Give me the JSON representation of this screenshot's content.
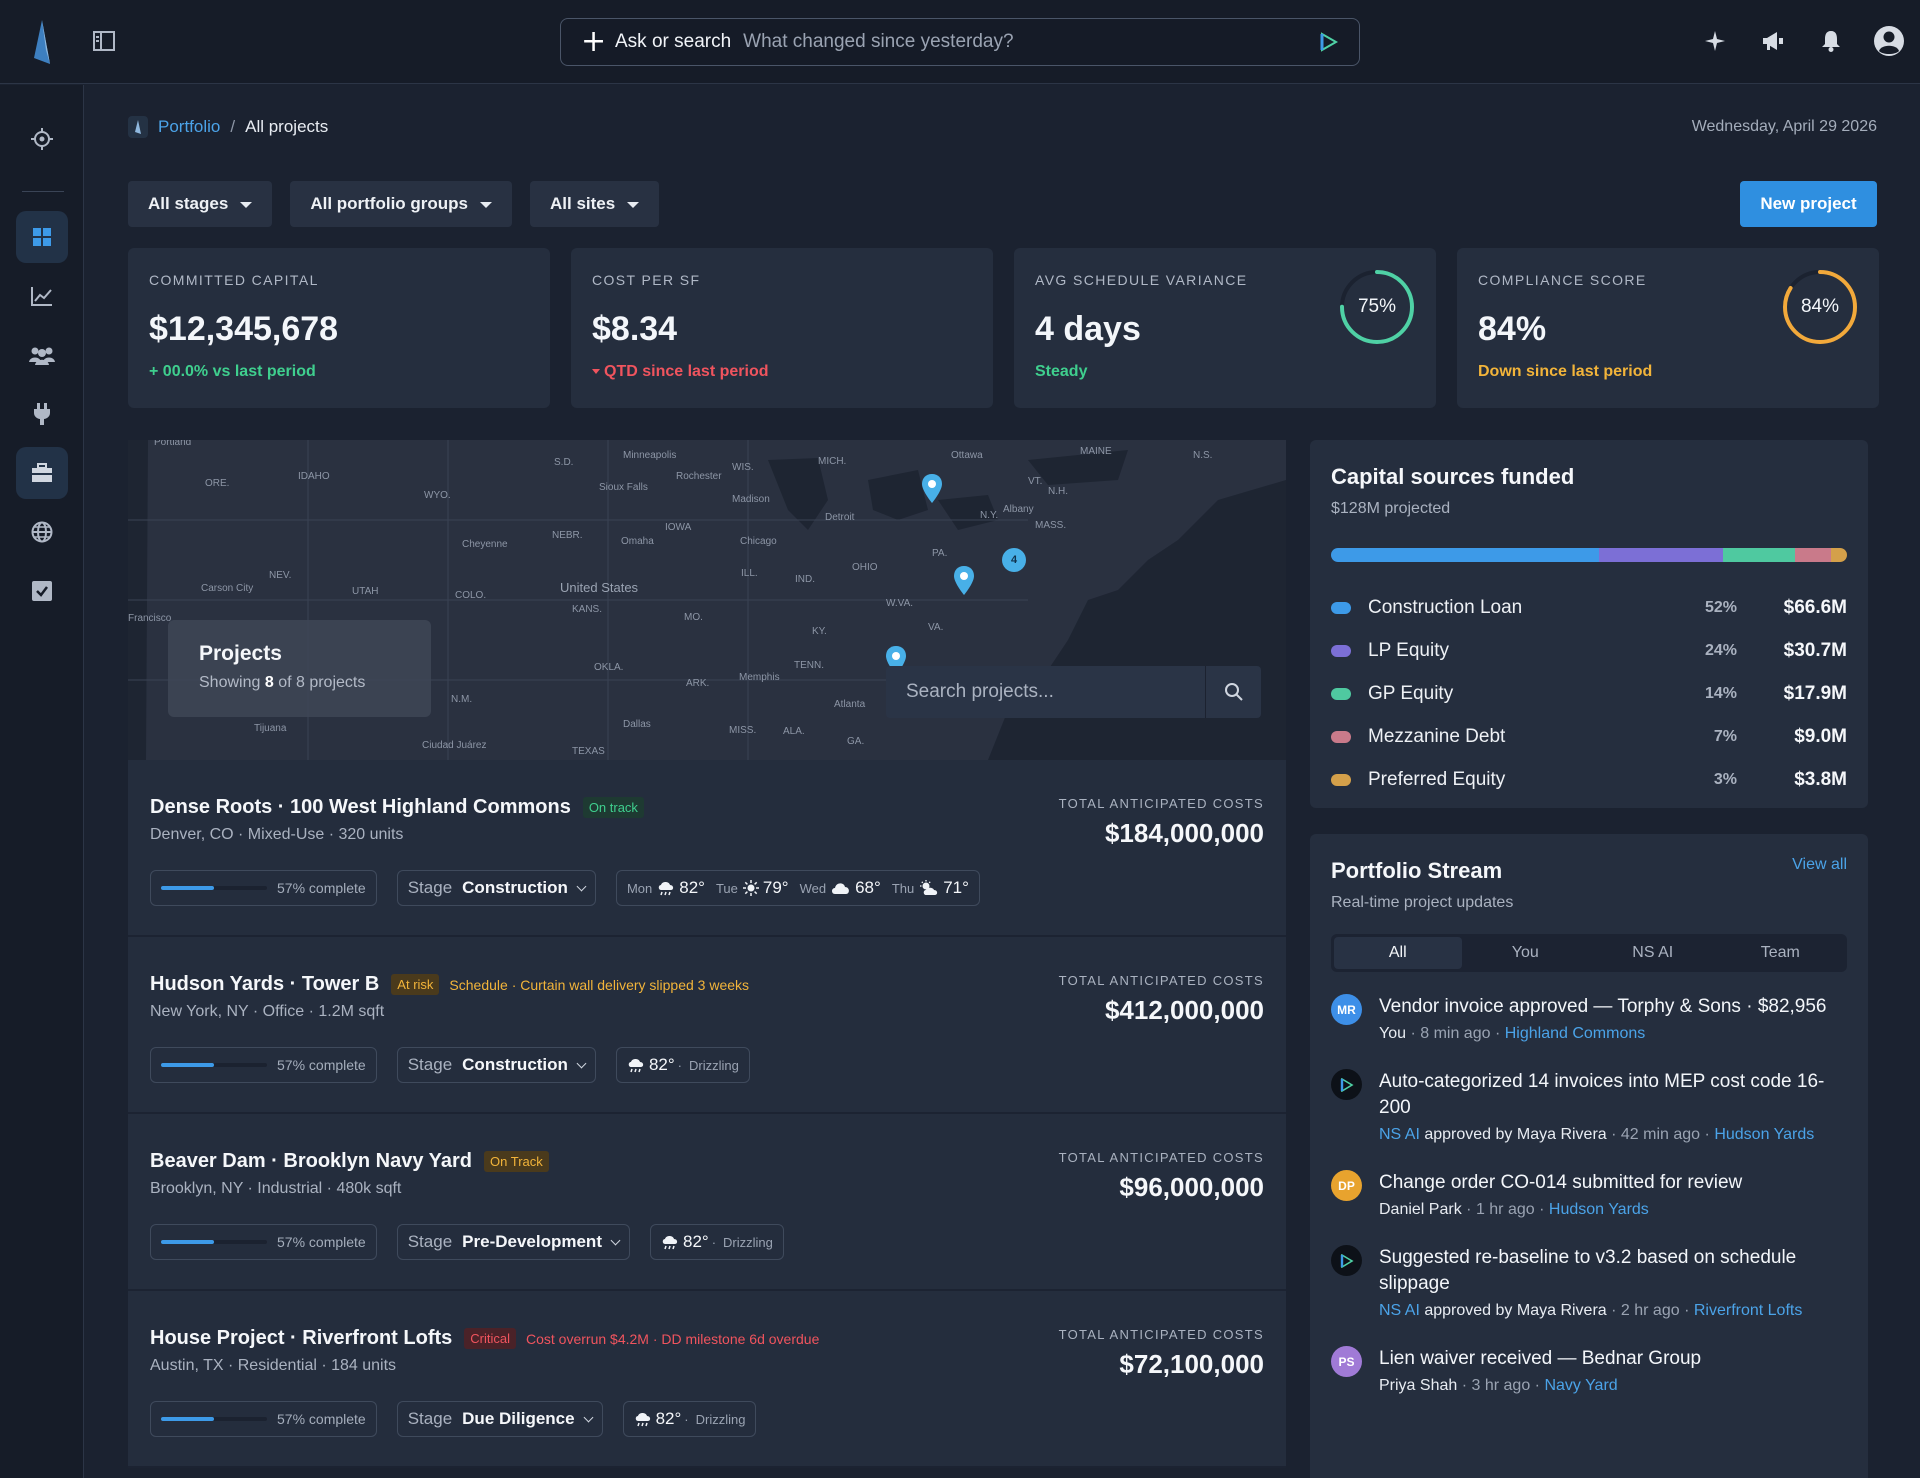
{
  "app": {
    "search_label": "Ask or search",
    "search_placeholder": "What changed since yesterday?"
  },
  "breadcrumb": {
    "root": "Portfolio",
    "current": "All projects"
  },
  "date": "Wednesday, April 29 2026",
  "filters": [
    "All stages",
    "All portfolio groups",
    "All sites"
  ],
  "new_project_label": "New project",
  "kpis": [
    {
      "label": "COMMITTED CAPITAL",
      "value": "$12,345,678",
      "sub": "+ 00.0% vs last period",
      "sub_color": "#3fcf8e"
    },
    {
      "label": "COST PER SF",
      "value": "$8.34",
      "sub": "QTD since last period",
      "sub_color": "#f0545e"
    },
    {
      "label": "AVG SCHEDULE VARIANCE",
      "value": "4 days",
      "sub": "Steady",
      "sub_color": "#3fcf8e",
      "ring_text": "75%",
      "ring_value": 0.75,
      "ring_color": "#4fd1a5"
    },
    {
      "label": "COMPLIANCE SCORE",
      "value": "84%",
      "sub": "Down since last period",
      "sub_color": "#f2b43a",
      "ring_text": "84%",
      "ring_value": 0.84,
      "ring_color": "#f2a93b"
    }
  ],
  "map": {
    "overlay_title": "Projects",
    "overlay_prefix": "Showing",
    "overlay_count": "8",
    "overlay_suffix": "of 8 projects",
    "search_placeholder": "Search projects...",
    "cluster_count": "4",
    "labels": [
      "Minneapolis",
      "Ottawa",
      "MAINE",
      "N.S.",
      "MICH.",
      "Rochester",
      "WIS.",
      "Sioux Falls",
      "S.D.",
      "Madison",
      "IDAHO",
      "ORE.",
      "WYO.",
      "Albany",
      "N.Y.",
      "VT.",
      "N.H.",
      "MASS.",
      "Detroit",
      "IOWA",
      "NEBR.",
      "Omaha",
      "Chicago",
      "Cheyenne",
      "PA.",
      "NEV.",
      "Carson City",
      "UTAH",
      "COLO.",
      "ILL.",
      "IND.",
      "OHIO",
      "United States",
      "KANS.",
      "MO.",
      "W.VA.",
      "VA.",
      "Francisco",
      "KY.",
      "TENN.",
      "OKLA.",
      "ARK.",
      "Memphis",
      "Atlanta",
      "N.M.",
      "Tijuana",
      "Dallas",
      "MISS.",
      "ALA.",
      "GA.",
      "Ciudad Juárez",
      "TEXAS",
      "Portland"
    ]
  },
  "projects": [
    {
      "name": "Dense Roots · 100 West Highland Commons",
      "badge": "On track",
      "badge_fg": "#3fcf8e",
      "badge_bg": "#1e3a32",
      "note": "",
      "note_color": "",
      "meta": "Denver, CO · Mixed-Use · 320 units",
      "cost_label": "TOTAL ANTICIPATED COSTS",
      "cost": "$184,000,000",
      "progress": 0.57,
      "progress_label": "57% complete",
      "stage_label": "Stage",
      "stage": "Construction",
      "forecast": [
        {
          "day": "Mon",
          "icon": "rain-cloud-icon",
          "temp": "82°"
        },
        {
          "day": "Tue",
          "icon": "sun-icon",
          "temp": "79°"
        },
        {
          "day": "Wed",
          "icon": "cloud-icon",
          "temp": "68°"
        },
        {
          "day": "Thu",
          "icon": "partly-sunny-icon",
          "temp": "71°"
        }
      ]
    },
    {
      "name": "Hudson Yards · Tower B",
      "badge": "At risk",
      "badge_fg": "#f2b43a",
      "badge_bg": "#4a3a1c",
      "note": "Schedule · Curtain wall delivery slipped 3 weeks",
      "note_color": "#f2b43a",
      "meta": "New York, NY · Office · 1.2M sqft",
      "cost_label": "TOTAL ANTICIPATED COSTS",
      "cost": "$412,000,000",
      "progress": 0.57,
      "progress_label": "57% complete",
      "stage_label": "Stage",
      "stage": "Construction",
      "weather": {
        "temp": "82°",
        "condition": "Drizzling"
      }
    },
    {
      "name": "Beaver Dam · Brooklyn Navy Yard",
      "badge": "On Track",
      "badge_fg": "#f2b43a",
      "badge_bg": "#4a3a1c",
      "note": "",
      "note_color": "",
      "meta": "Brooklyn, NY · Industrial · 480k sqft",
      "cost_label": "TOTAL ANTICIPATED COSTS",
      "cost": "$96,000,000",
      "progress": 0.57,
      "progress_label": "57% complete",
      "stage_label": "Stage",
      "stage": "Pre-Development",
      "weather": {
        "temp": "82°",
        "condition": "Drizzling"
      }
    },
    {
      "name": "House Project · Riverfront Lofts",
      "badge": "Critical",
      "badge_fg": "#f0545e",
      "badge_bg": "#4a2228",
      "note": "Cost overrun $4.2M · DD milestone 6d overdue",
      "note_color": "#f0545e",
      "meta": "Austin, TX · Residential · 184 units",
      "cost_label": "TOTAL ANTICIPATED COSTS",
      "cost": "$72,100,000",
      "progress": 0.57,
      "progress_label": "57% complete",
      "stage_label": "Stage",
      "stage": "Due Diligence",
      "weather": {
        "temp": "82°",
        "condition": "Drizzling"
      }
    }
  ],
  "capital": {
    "title": "Capital sources funded",
    "subtitle": "$128M projected",
    "sources": [
      {
        "name": "Construction Loan",
        "pct": "52%",
        "share": 0.52,
        "value": "$66.6M",
        "color": "#3d9ae8"
      },
      {
        "name": "LP Equity",
        "pct": "24%",
        "share": 0.24,
        "value": "$30.7M",
        "color": "#7c6fd6"
      },
      {
        "name": "GP Equity",
        "pct": "14%",
        "share": 0.14,
        "value": "$17.9M",
        "color": "#4fc9a0"
      },
      {
        "name": "Mezzanine Debt",
        "pct": "7%",
        "share": 0.07,
        "value": "$9.0M",
        "color": "#c97a8a"
      },
      {
        "name": "Preferred Equity",
        "pct": "3%",
        "share": 0.03,
        "value": "$3.8M",
        "color": "#d4a04a"
      }
    ]
  },
  "stream": {
    "title": "Portfolio Stream",
    "subtitle": "Real-time project updates",
    "view_all": "View all",
    "tabs": [
      "All",
      "You",
      "NS AI",
      "Team"
    ],
    "items": [
      {
        "avatar": "MR",
        "avatar_color": "#3d8fe8",
        "title": "Vendor invoice approved — Torphy & Sons · $82,956",
        "who": "You",
        "ai": "",
        "mid": "",
        "time": "8 min ago",
        "project": "Highland Commons"
      },
      {
        "avatar": "",
        "avatar_color": "",
        "title": "Auto-categorized 14 invoices into MEP cost code 16-200",
        "who": "",
        "ai": "NS AI",
        "mid": "approved by Maya Rivera",
        "time": "42 min ago",
        "project": "Hudson Yards"
      },
      {
        "avatar": "DP",
        "avatar_color": "#e8a32e",
        "title": "Change order CO-014 submitted for review",
        "who": "Daniel Park",
        "ai": "",
        "mid": "",
        "time": "1 hr ago",
        "project": "Hudson Yards"
      },
      {
        "avatar": "",
        "avatar_color": "",
        "title": "Suggested re-baseline to v3.2 based on schedule slippage",
        "who": "",
        "ai": "NS AI",
        "mid": "approved by Maya Rivera",
        "time": "2 hr ago",
        "project": "Riverfront Lofts"
      },
      {
        "avatar": "PS",
        "avatar_color": "#a07ad6",
        "title": "Lien waiver received — Bednar Group",
        "who": "Priya Shah",
        "ai": "",
        "mid": "",
        "time": "3 hr ago",
        "project": "Navy Yard"
      }
    ]
  }
}
